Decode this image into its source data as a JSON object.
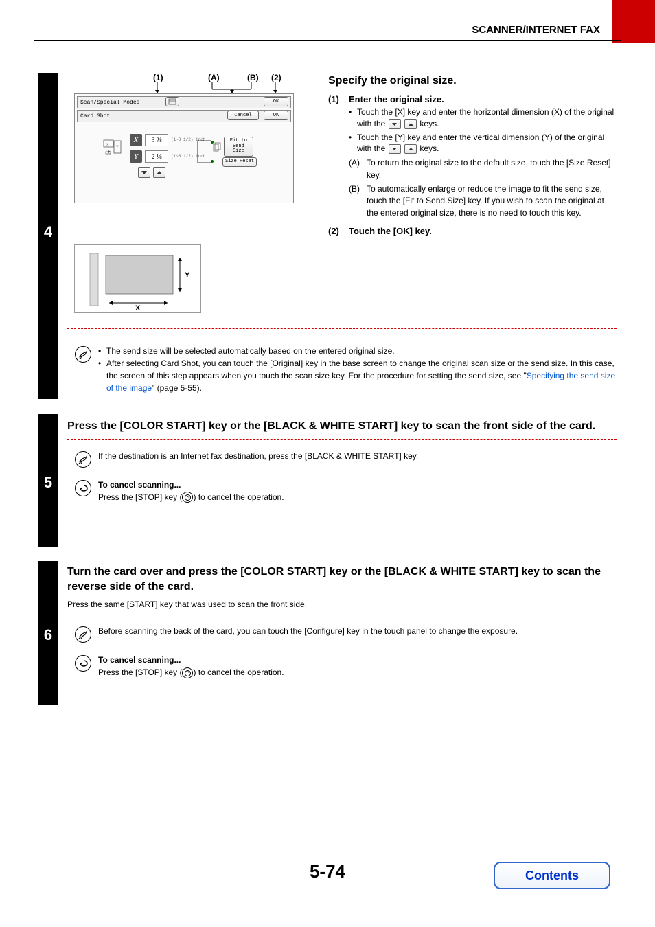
{
  "header": {
    "chapter": "SCANNER/INTERNET FAX"
  },
  "step4": {
    "number": "4",
    "callouts": {
      "c1": "(1)",
      "cA": "(A)",
      "cB": "(B)",
      "c2": "(2)"
    },
    "panel": {
      "row1": "Scan/Special Modes",
      "row1_ok": "OK",
      "row2": "Card Shot",
      "row2_cancel": "Cancel",
      "row2_ok": "OK",
      "x_label": "X",
      "x_value": "3 ⅜",
      "x_range": "(1~8 1/2) inch",
      "y_label": "Y",
      "y_value": "2 ⅛",
      "y_range": "(1~8 1/2) inch",
      "fit": "Fit to Send Size",
      "reset": "Size Reset"
    },
    "diagram": {
      "x": "X",
      "y": "Y"
    },
    "right": {
      "title": "Specify the original size.",
      "s1_n": "(1)",
      "s1_t": "Enter the original size.",
      "b1a": "Touch the [X] key and enter the horizontal dimension (X) of the original with the ",
      "b1b": " keys.",
      "b2a": "Touch the [Y] key and enter the vertical dimension (Y) of the original with the ",
      "b2b": " keys.",
      "A_n": "(A)",
      "A_t": "To return the original size to the default size, touch the [Size Reset] key.",
      "B_n": "(B)",
      "B_t": "To automatically enlarge or reduce the image to fit the send size, touch the [Fit to Send Size] key. If you wish to scan the original at the entered original size, there is no need to touch this key.",
      "s2_n": "(2)",
      "s2_t": "Touch the [OK] key."
    },
    "notes": {
      "n1": "The send size will be selected automatically based on the entered original size.",
      "n2a": "After selecting Card Shot, you can touch the [Original] key in the base screen to change the original scan size or the send size. In this case, the screen of this step appears when you touch the scan size key. For the procedure for setting the send size, see \"",
      "n2link": "Specifying the send size of the image",
      "n2b": "\" (page 5-55)."
    }
  },
  "step5": {
    "number": "5",
    "heading": "Press the [COLOR START] key or the [BLACK & WHITE START] key to scan the front side of the card.",
    "note1": "If the destination is an Internet fax destination, press the [BLACK & WHITE START] key.",
    "cancel_h": "To cancel scanning...",
    "cancel_t1": "Press the [STOP] key (",
    "cancel_t2": ") to cancel the operation."
  },
  "step6": {
    "number": "6",
    "heading": "Turn the card over and press the [COLOR START] key or the [BLACK & WHITE START] key to scan the reverse side of the card.",
    "sub": "Press the same [START] key that was used to scan the front side.",
    "note1": "Before scanning the back of the card, you can touch the [Configure] key in the touch panel to change the exposure.",
    "cancel_h": "To cancel scanning...",
    "cancel_t1": "Press the [STOP] key (",
    "cancel_t2": ") to cancel the operation."
  },
  "footer": {
    "page": "5-74",
    "contents": "Contents"
  }
}
